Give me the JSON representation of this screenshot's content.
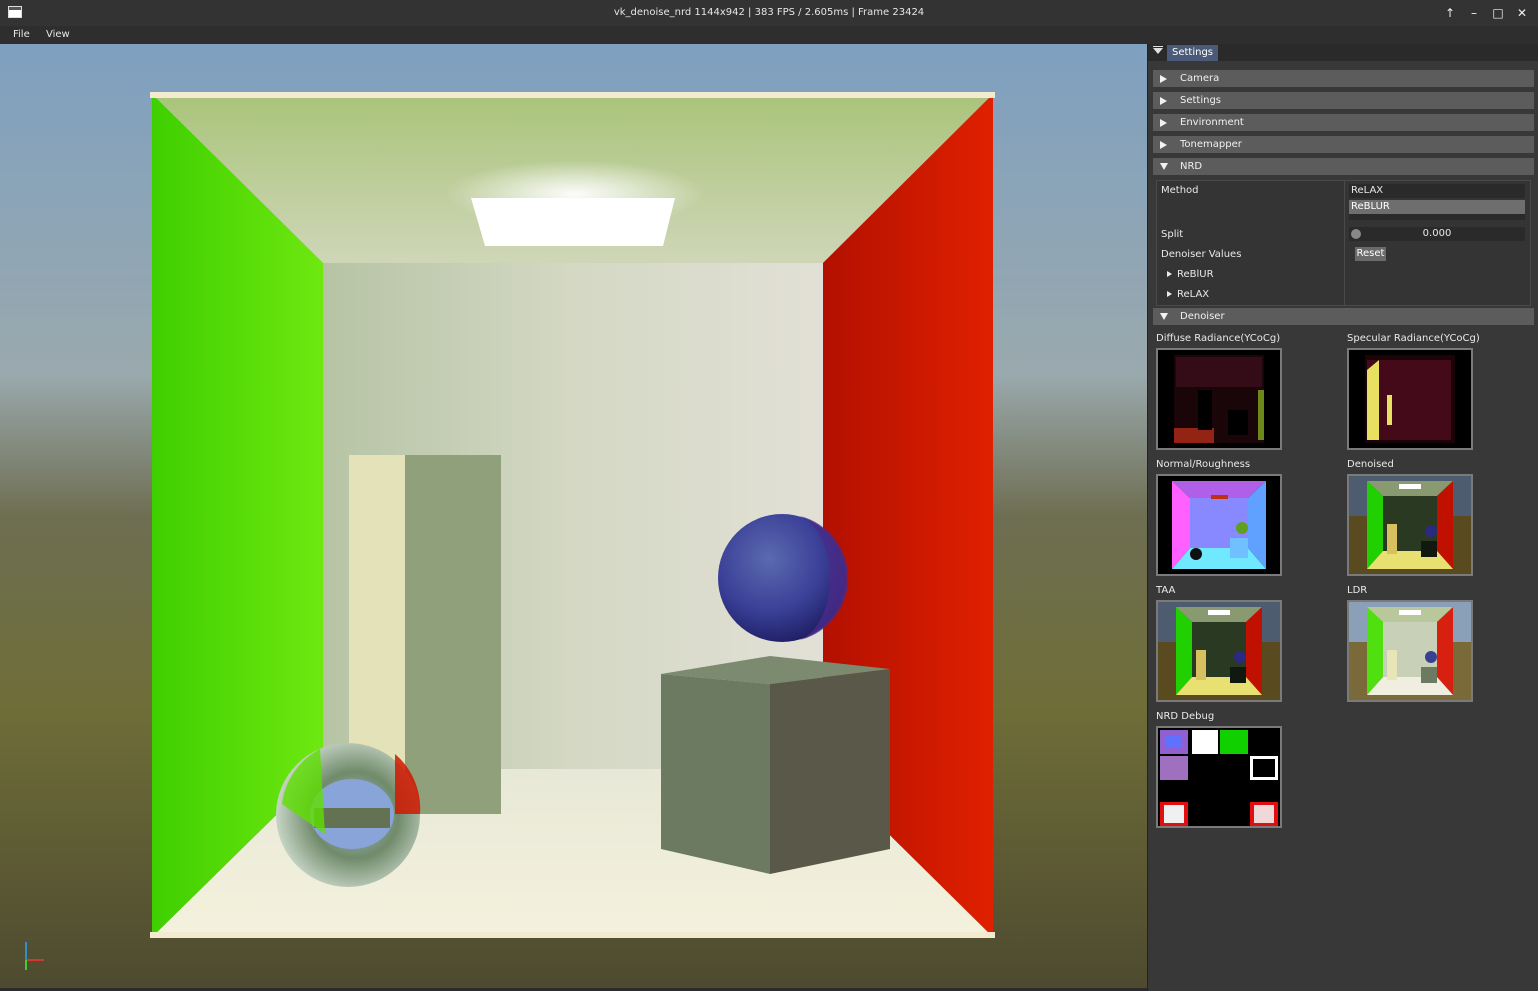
{
  "window": {
    "title": "vk_denoise_nrd 1144x942 | 383 FPS / 2.605ms | Frame 23424",
    "controls": [
      "↑",
      "–",
      "□",
      "✕"
    ]
  },
  "menu": {
    "items": [
      "File",
      "View"
    ]
  },
  "panel": {
    "tab_label": "Settings",
    "sections": [
      {
        "label": "Camera",
        "expanded": false
      },
      {
        "label": "Settings",
        "expanded": false
      },
      {
        "label": "Environment",
        "expanded": false
      },
      {
        "label": "Tonemapper",
        "expanded": false
      },
      {
        "label": "NRD",
        "expanded": true
      },
      {
        "label": "Denoiser",
        "expanded": true
      }
    ],
    "nrd": {
      "method_label": "Method",
      "method_options": [
        "ReLAX",
        "ReBLUR"
      ],
      "method_selected": "ReBLUR",
      "split_label": "Split",
      "split_value": "0.000",
      "split_fraction": 0.0,
      "denoiser_values_label": "Denoiser Values",
      "reset_label": "Reset",
      "subsections": [
        "ReBlUR",
        "ReLAX"
      ]
    },
    "denoiser": {
      "images": [
        {
          "label": "Diffuse Radiance(YCoCg)",
          "icon": "diffuse-radiance-preview"
        },
        {
          "label": "Specular Radiance(YCoCg)",
          "icon": "specular-radiance-preview"
        },
        {
          "label": "Normal/Roughness",
          "icon": "normal-roughness-preview"
        },
        {
          "label": "Denoised",
          "icon": "denoised-preview"
        },
        {
          "label": "TAA",
          "icon": "taa-preview"
        },
        {
          "label": "LDR",
          "icon": "ldr-preview"
        },
        {
          "label": "NRD Debug",
          "icon": "nrd-debug-preview"
        }
      ]
    }
  },
  "colors": {
    "panel_bg": "#383838",
    "header_bg": "#5c5c5c",
    "tab_active": "#4a5a78",
    "wall_green": "#5ee000",
    "wall_red": "#d81800"
  }
}
